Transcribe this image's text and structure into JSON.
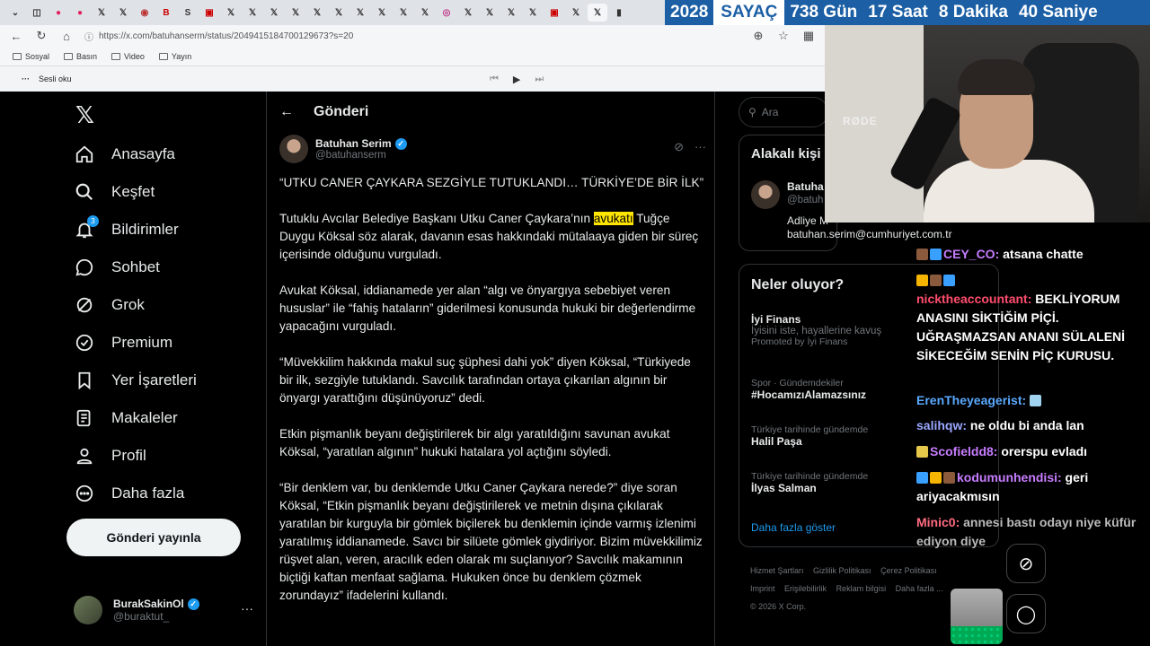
{
  "browser": {
    "url": "https://x.com/batuhanserm/status/2049415184700129673?s=20",
    "bookmarks": [
      "Sosyal",
      "Basın",
      "Video",
      "Yayın"
    ],
    "reader_label": "Sesli oku"
  },
  "counter": {
    "year": "2028",
    "label": "SAYAÇ",
    "days": "738 Gün",
    "hours": "17 Saat",
    "minutes": "8 Dakika",
    "seconds": "40 Saniye"
  },
  "nav": {
    "items": [
      {
        "label": "Anasayfa",
        "icon": "home-icon"
      },
      {
        "label": "Keşfet",
        "icon": "search-icon"
      },
      {
        "label": "Bildirimler",
        "icon": "bell-icon",
        "badge": "3"
      },
      {
        "label": "Sohbet",
        "icon": "chat-icon"
      },
      {
        "label": "Grok",
        "icon": "grok-icon"
      },
      {
        "label": "Premium",
        "icon": "premium-icon"
      },
      {
        "label": "Yer İşaretleri",
        "icon": "bookmark-icon"
      },
      {
        "label": "Makaleler",
        "icon": "article-icon"
      },
      {
        "label": "Profil",
        "icon": "profile-icon"
      },
      {
        "label": "Daha fazla",
        "icon": "more-icon"
      }
    ],
    "post_button": "Gönderi yayınla",
    "account": {
      "name": "BurakSakinOl",
      "handle": "@buraktut_"
    }
  },
  "main": {
    "title": "Gönderi",
    "author": {
      "name": "Batuhan Serim",
      "handle": "@batuhanserm"
    },
    "tweet": {
      "headline": "“UTKU CANER ÇAYKARA SEZGİYLE TUTUKLANDI… TÜRKİYE’DE BİR İLK”",
      "p1_before": "Tutuklu Avcılar Belediye Başkanı Utku Caner Çaykara’nın ",
      "p1_highlight": "avukatı",
      "p1_after": " Tuğçe Duygu Köksal söz alarak, davanın esas hakkındaki mütalaaya giden bir süreç içerisinde olduğunu vurguladı.",
      "p2": "Avukat Köksal, iddianamede yer alan “algı ve önyargıya sebebiyet veren hususlar” ile “fahiş hataların” giderilmesi konusunda hukuki bir değerlendirme yapacağını vurguladı.",
      "p3": "“Müvekkilim hakkında makul suç şüphesi dahi yok” diyen Köksal, “Türkiyede bir ilk, sezgiyle tutuklandı. Savcılık tarafından ortaya çıkarılan algının bir önyargı yarattığını düşünüyoruz” dedi.",
      "p4": "Etkin pişmanlık beyanı değiştirilerek bir algı yaratıldığını savunan avukat Köksal, “yaratılan algının” hukuki hatalara yol açtığını söyledi.",
      "p5": "“Bir denklem var, bu denklemde Utku Caner Çaykara nerede?” diye soran Köksal, “Etkin pişmanlık beyanı değiştirilerek ve metnin dışına çıkılarak yaratılan bir kurguyla bir gömlek biçilerek bu denklemin içinde varmış izlenimi yaratılmış iddianamede. Savcı bir silüete gömlek giydiriyor. Bizim müvekkilimiz rüşvet alan, veren, aracılık eden olarak mı suçlanıyor? Savcılık makamının biçtiği kaftan menfaat sağlama. Hukuken önce bu denklem çözmek zorundayız” ifadelerini kullandı."
    }
  },
  "right": {
    "search_placeholder": "Ara",
    "related_title": "Alakalı kişi",
    "related": {
      "name": "Batuha",
      "handle": "@batuh",
      "bio_prefix": "Adliye M",
      "email": "batuhan.serim@cumhuriyet.com.tr"
    },
    "trends_title": "Neler oluyor?",
    "trends": [
      {
        "meta": "",
        "name": "İyi Finans",
        "sub": "İyisini iste, hayallerine kavuş",
        "extra": "Promoted by İyi Finans"
      },
      {
        "meta": "Spor · Gündemdekiler",
        "name": "#HocamızıAlamazsınız",
        "sub": "",
        "extra": ""
      },
      {
        "meta": "Türkiye tarihinde gündemde",
        "name": "Halil Paşa",
        "sub": "",
        "extra": ""
      },
      {
        "meta": "Türkiye tarihinde gündemde",
        "name": "İlyas Salman",
        "sub": "",
        "extra": ""
      }
    ],
    "show_more": "Daha fazla göster",
    "footer": [
      "Hizmet Şartları",
      "Gizlilik Politikası",
      "Çerez Politikası",
      "Imprint",
      "Erişilebilirlik",
      "Reklam bilgisi",
      "Daha fazla ...",
      "© 2026 X Corp."
    ]
  },
  "webcam": {
    "mic_brand": "RØDE"
  },
  "chat": [
    {
      "user": "CEY_CO:",
      "text": " atsana chatte",
      "color": "#c77dff"
    },
    {
      "user": "nicktheaccountant:",
      "text": " BEKLİYORUM ANASINI SİKTİĞİM PİÇİ. UĞRAŞMAZSAN ANANI SÜLALENİ SİKECEĞİM SENİN PİÇ KURUSU.",
      "color": "#ff4d6d"
    },
    {
      "user": "ErenTheyeagerist:",
      "text": "",
      "color": "#5aa9ff"
    },
    {
      "user": "salihqw:",
      "text": " ne oldu bi anda lan",
      "color": "#9aa7ff"
    },
    {
      "user": "Scofieldd8:",
      "text": " orerspu evladı",
      "color": "#c77dff"
    },
    {
      "user": "kodumunhendisi:",
      "text": " geri ariyacakmısın",
      "color": "#c77dff"
    },
    {
      "user": "Minic0:",
      "text": " annesi bastı odayı niye küfür ediyon diye",
      "color": "#ff6b81"
    }
  ],
  "colors": {
    "accent": "#1d9bf0",
    "counter_bg": "#1c5fa5",
    "highlight": "#ffe600"
  }
}
